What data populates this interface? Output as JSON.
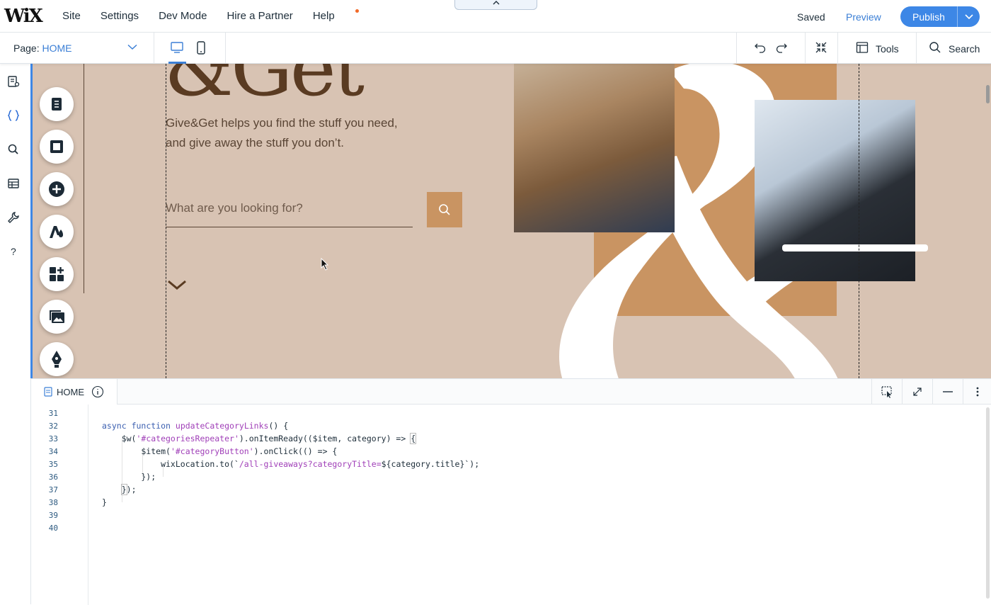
{
  "topbar": {
    "logo": "WiX",
    "nav": [
      "Site",
      "Settings",
      "Dev Mode",
      "Hire a Partner",
      "Help"
    ],
    "saved": "Saved",
    "preview": "Preview",
    "publish": "Publish",
    "help_has_notification": true
  },
  "pagebar": {
    "page_label": "Page:",
    "page_name": "HOME",
    "tools": "Tools",
    "search": "Search"
  },
  "canvas": {
    "headline_partial": "&Get",
    "tagline_line1": "Give&Get helps you find the stuff you need,",
    "tagline_line2": "and give away the stuff you don’t.",
    "search_placeholder": "What are you looking for?"
  },
  "code_panel": {
    "tab_name": "HOME",
    "line_numbers": [
      "31",
      "32",
      "33",
      "34",
      "35",
      "36",
      "37",
      "38",
      "39",
      "40"
    ]
  },
  "colors": {
    "accent": "#3d87e6",
    "canvas_bg": "#d8c3b3",
    "brand_tan": "#c99462",
    "text_brown": "#5a3b22"
  },
  "icons": {
    "leftbar": [
      "pages-icon",
      "code-braces-icon",
      "search-icon",
      "database-icon",
      "wrench-icon",
      "help-icon"
    ],
    "tools": [
      "pages-menu-icon",
      "strip-icon",
      "add-icon",
      "design-icon",
      "apps-add-icon",
      "media-icon",
      "pen-icon"
    ]
  }
}
